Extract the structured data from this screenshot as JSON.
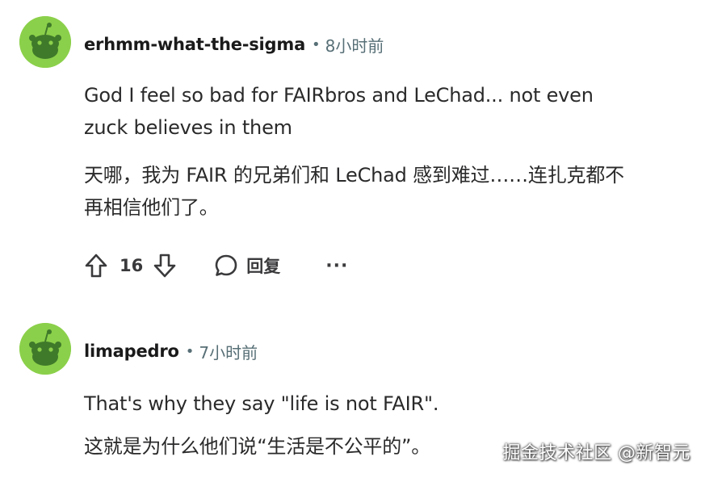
{
  "comments": [
    {
      "username": "erhmm-what-the-sigma",
      "separator": "•",
      "time": "8小时前",
      "text_en": "God I feel so bad for FAIRbros and LeChad... not even zuck believes in them",
      "text_zh": "天哪，我为 FAIR 的兄弟们和 LeChad 感到难过……连扎克都不再相信他们了。",
      "vote_count": "16",
      "reply_label": "回复",
      "more_label": "···"
    },
    {
      "username": "limapedro",
      "separator": "•",
      "time": "7小时前",
      "text_en": "That's why they say \"life is not FAIR\".",
      "text_zh": "这就是为什么他们说“生活是不公平的”。"
    }
  ],
  "watermark": "掘金技术社区 @新智元",
  "colors": {
    "avatar_bg": "#8bd04a",
    "text": "#1a1a1b",
    "meta_gray": "#576f76"
  },
  "icons": {
    "avatar": "reddit-snoo-icon",
    "upvote": "arrow-up-icon",
    "downvote": "arrow-down-icon",
    "reply": "speech-bubble-icon",
    "more": "ellipsis-icon"
  }
}
